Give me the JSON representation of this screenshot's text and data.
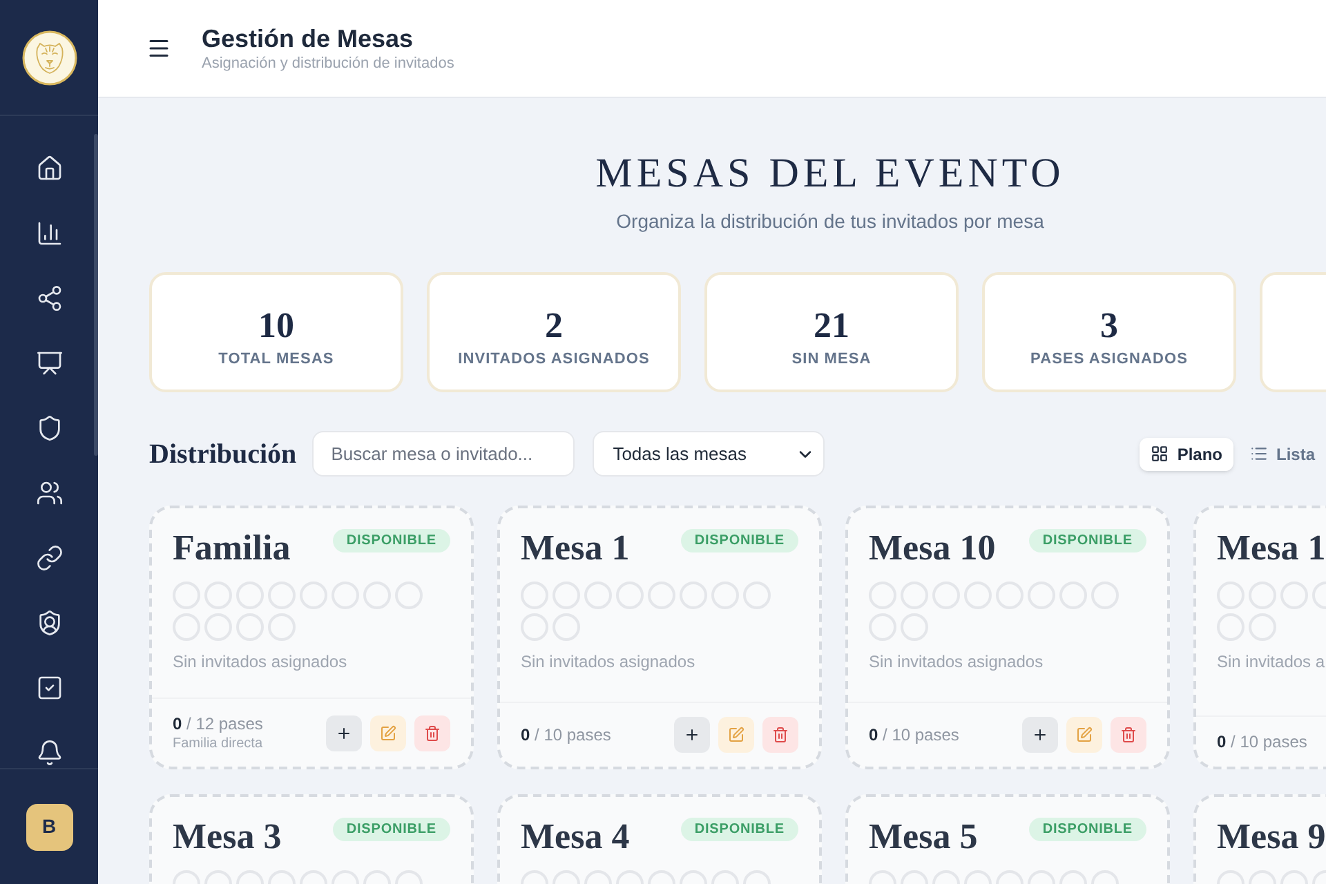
{
  "sidebar": {
    "avatar": "B"
  },
  "header": {
    "title": "Gestión de Mesas",
    "subtitle": "Asignación y distribución de invitados"
  },
  "page": {
    "heading": "MESAS DEL EVENTO",
    "subheading": "Organiza la distribución de tus invitados por mesa"
  },
  "stats": [
    {
      "kind": "figure",
      "value": "10",
      "label": "TOTAL MESAS"
    },
    {
      "kind": "figure",
      "value": "2",
      "label": "INVITADOS ASIGNADOS"
    },
    {
      "kind": "figure",
      "value": "21",
      "label": "SIN MESA"
    },
    {
      "kind": "figure",
      "value": "3",
      "label": "PASES ASIGNADOS"
    },
    {
      "kind": "cut_off"
    }
  ],
  "toolbar": {
    "title": "Distribución",
    "search": {
      "placeholder": "Buscar mesa o invitado..."
    },
    "filter": {
      "value": "Todas las mesas"
    },
    "views": [
      {
        "label": "Plano",
        "kind": "grid",
        "selected": true
      },
      {
        "label": "Lista",
        "kind": "list",
        "selected": false
      }
    ]
  },
  "tables": [
    {
      "name": "Familia",
      "status": {
        "label": "DISPONIBLE",
        "kind": "available"
      },
      "seat_rows": [
        [
          {
            "occupied": false
          },
          {
            "occupied": false
          },
          {
            "occupied": false
          },
          {
            "occupied": false
          },
          {
            "occupied": false
          },
          {
            "occupied": false
          },
          {
            "occupied": false
          },
          {
            "occupied": false
          }
        ],
        [
          {
            "occupied": false
          },
          {
            "occupied": false
          },
          {
            "occupied": false
          },
          {
            "occupied": false
          }
        ]
      ],
      "empty_text": "Sin invitados asignados",
      "passes": "**0** / 12 pases",
      "note": "Familia directa",
      "actions": [
        {
          "kind": "add"
        },
        {
          "kind": "edit"
        },
        {
          "kind": "delete"
        }
      ]
    },
    {
      "name": "Mesa 1",
      "status": {
        "label": "DISPONIBLE",
        "kind": "available"
      },
      "seat_rows": [
        [
          {
            "occupied": false
          },
          {
            "occupied": false
          },
          {
            "occupied": false
          },
          {
            "occupied": false
          },
          {
            "occupied": false
          },
          {
            "occupied": false
          },
          {
            "occupied": false
          },
          {
            "occupied": false
          }
        ],
        [
          {
            "occupied": false
          },
          {
            "occupied": false
          }
        ]
      ],
      "empty_text": "Sin invitados asignados",
      "passes": "**0** / 10 pases",
      "actions": [
        {
          "kind": "add"
        },
        {
          "kind": "edit"
        },
        {
          "kind": "delete"
        }
      ]
    },
    {
      "name": "Mesa 10",
      "status": {
        "label": "DISPONIBLE",
        "kind": "available"
      },
      "seat_rows": [
        [
          {
            "occupied": false
          },
          {
            "occupied": false
          },
          {
            "occupied": false
          },
          {
            "occupied": false
          },
          {
            "occupied": false
          },
          {
            "occupied": false
          },
          {
            "occupied": false
          },
          {
            "occupied": false
          }
        ],
        [
          {
            "occupied": false
          },
          {
            "occupied": false
          }
        ]
      ],
      "empty_text": "Sin invitados asignados",
      "passes": "**0** / 10 pases",
      "actions": [
        {
          "kind": "add"
        },
        {
          "kind": "edit"
        },
        {
          "kind": "delete"
        }
      ]
    },
    {
      "name": "Mesa 1",
      "seat_rows": [
        [
          {
            "occupied": false
          },
          {
            "occupied": false
          },
          {
            "occupied": false
          },
          {
            "occupied": false
          }
        ],
        [
          {
            "occupied": false
          },
          {
            "occupied": false
          }
        ]
      ],
      "empty_text": "Sin invitados a",
      "passes": "**0** / 10 pases"
    },
    {
      "name": "Mesa 3",
      "status": {
        "label": "DISPONIBLE",
        "kind": "available"
      },
      "seat_rows": [
        [
          {
            "occupied": false
          },
          {
            "occupied": false
          },
          {
            "occupied": false
          },
          {
            "occupied": false
          },
          {
            "occupied": false
          },
          {
            "occupied": false
          },
          {
            "occupied": false
          },
          {
            "occupied": false
          }
        ]
      ]
    },
    {
      "name": "Mesa 4",
      "status": {
        "label": "DISPONIBLE",
        "kind": "available"
      },
      "seat_rows": [
        [
          {
            "occupied": false
          },
          {
            "occupied": false
          },
          {
            "occupied": false
          },
          {
            "occupied": false
          },
          {
            "occupied": false
          },
          {
            "occupied": false
          },
          {
            "occupied": false
          },
          {
            "occupied": false
          }
        ]
      ]
    },
    {
      "name": "Mesa 5",
      "status": {
        "label": "DISPONIBLE",
        "kind": "available"
      },
      "seat_rows": [
        [
          {
            "occupied": false
          },
          {
            "occupied": false
          },
          {
            "occupied": false
          },
          {
            "occupied": false
          },
          {
            "occupied": false
          },
          {
            "occupied": false
          },
          {
            "occupied": false
          },
          {
            "occupied": false
          }
        ]
      ]
    },
    {
      "name": "Mesa 9",
      "seat_rows": [
        [
          {
            "occupied": false
          },
          {
            "occupied": false
          },
          {
            "occupied": false
          },
          {
            "occupied": false
          }
        ]
      ]
    }
  ]
}
